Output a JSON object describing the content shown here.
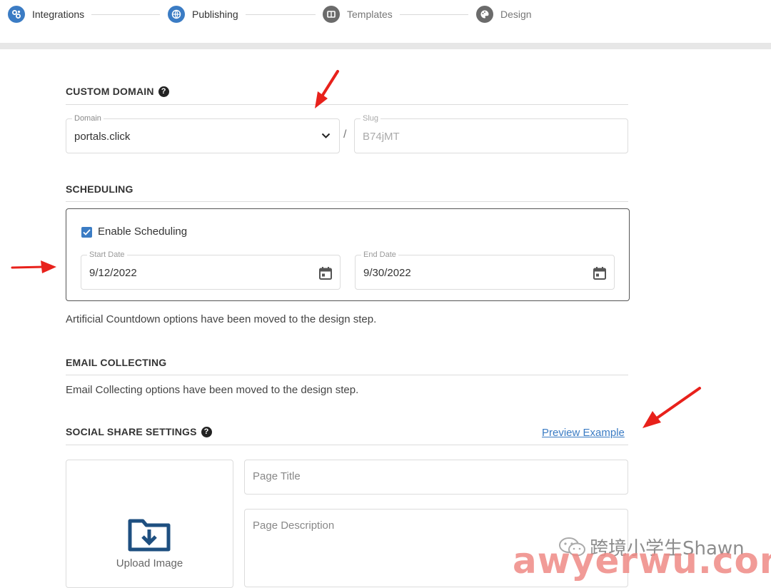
{
  "stepper": {
    "steps": [
      {
        "label": "Integrations",
        "state": "active",
        "icon": "gears-icon"
      },
      {
        "label": "Publishing",
        "state": "active",
        "icon": "globe-icon"
      },
      {
        "label": "Templates",
        "state": "inactive",
        "icon": "layout-icon"
      },
      {
        "label": "Design",
        "state": "inactive",
        "icon": "palette-icon"
      }
    ]
  },
  "custom_domain": {
    "title": "CUSTOM DOMAIN",
    "help": "?",
    "domain_label": "Domain",
    "domain_value": "portals.click",
    "separator": "/",
    "slug_label": "Slug",
    "slug_value": "B74jMT"
  },
  "scheduling": {
    "title": "SCHEDULING",
    "enable_label": "Enable Scheduling",
    "enabled": true,
    "start_label": "Start Date",
    "start_value": "9/12/2022",
    "end_label": "End Date",
    "end_value": "9/30/2022",
    "note": "Artificial Countdown options have been moved to the design step."
  },
  "email_collecting": {
    "title": "EMAIL COLLECTING",
    "note": "Email Collecting options have been moved to the design step."
  },
  "social_share": {
    "title": "SOCIAL SHARE SETTINGS",
    "help": "?",
    "preview_link": "Preview Example",
    "upload_label": "Upload Image",
    "page_title_placeholder": "Page Title",
    "page_description_placeholder": "Page Description"
  },
  "watermark": {
    "account": "跨境小学生Shawn",
    "site": "awyerwu.com"
  },
  "colors": {
    "accent": "#3b7cc4",
    "annotation_arrow": "#e8211b",
    "watermark": "#ef8a86"
  }
}
